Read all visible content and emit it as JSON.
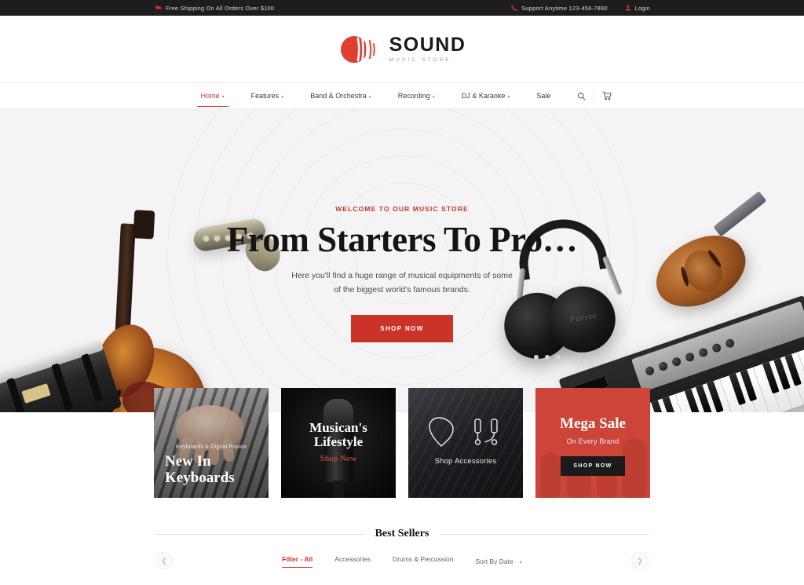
{
  "topbar": {
    "shipping": "Free Shipping On All Orders Over $100",
    "shipping_icon": "truck-icon",
    "support": "Support Anytime 123-456-7890",
    "support_icon": "phone-icon",
    "login": "Login",
    "login_icon": "user-icon"
  },
  "logo": {
    "title": "SOUND",
    "subtitle": "MUSIC STORE"
  },
  "nav": {
    "items": [
      {
        "label": "Home",
        "has_caret": true,
        "active": true
      },
      {
        "label": "Features",
        "has_caret": true,
        "active": false
      },
      {
        "label": "Band & Orchestra",
        "has_caret": true,
        "active": false
      },
      {
        "label": "Recording",
        "has_caret": true,
        "active": false
      },
      {
        "label": "DJ & Karaoke",
        "has_caret": true,
        "active": false
      },
      {
        "label": "Sale",
        "has_caret": false,
        "active": false
      }
    ],
    "search_icon": "search-icon",
    "cart_icon": "cart-icon"
  },
  "hero": {
    "eyebrow": "WELCOME TO OUR MUSIC STORE",
    "title": "From Starters To Pro…",
    "sub_line1": "Here you'll find a huge range of musical equipments of some",
    "sub_line2": "of the biggest world's famous brands.",
    "cta": "SHOP NOW",
    "headphone_brand": "Parrot"
  },
  "promos": [
    {
      "kicker": "Keyboards & Digital Pianos",
      "title_line1": "New In",
      "title_line2": "Keyboards"
    },
    {
      "title_line1": "Musican's",
      "title_line2": "Lifestyle",
      "link": "Shop Now"
    },
    {
      "label": "Shop Accessories"
    },
    {
      "title_line1": "Mega Sale",
      "subtitle": "On Every Brand",
      "button": "SHOP NOW"
    }
  ],
  "bestsellers": {
    "title": "Best Sellers",
    "filters": [
      {
        "label": "Filter - All",
        "active": true
      },
      {
        "label": "Accessories",
        "active": false
      },
      {
        "label": "Drums & Percussion",
        "active": false
      }
    ],
    "sort_label": "Sort By Date",
    "sort_caret": "chevron-down-icon",
    "prev_icon": "chevron-left-icon",
    "next_icon": "chevron-right-icon"
  },
  "colors": {
    "accent": "#cc3328",
    "dark": "#1d1d1d",
    "hero_bg": "#f4f4f4",
    "sale_bg": "#cc4538"
  }
}
